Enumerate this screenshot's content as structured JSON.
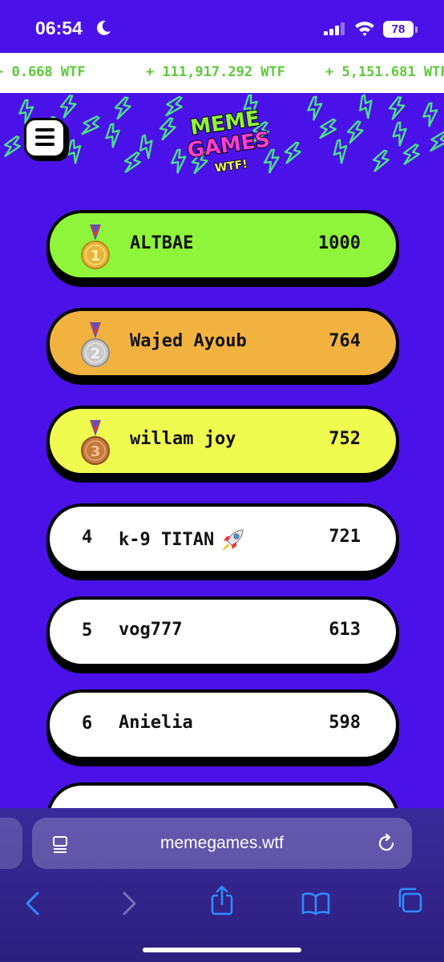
{
  "status_bar": {
    "time": "06:54",
    "battery": "78"
  },
  "ticker": {
    "items": [
      "+ 0.668 WTF",
      "+ 111,917.292 WTF",
      "+ 5,151.681 WTF"
    ]
  },
  "header": {
    "logo_line1": "MEME",
    "logo_line2": "GAMES",
    "logo_line3": "WTF!"
  },
  "leaderboard": {
    "rows": [
      {
        "rank": "1",
        "medal": "gold",
        "name": "ALTBAE",
        "score": "1000",
        "color": "#8ff53a"
      },
      {
        "rank": "2",
        "medal": "silver",
        "name": "Wajed Ayoub",
        "score": "764",
        "color": "#f2b240"
      },
      {
        "rank": "3",
        "medal": "bronze",
        "name": "willam joy",
        "score": "752",
        "color": "#f0fb4f"
      },
      {
        "rank": "4",
        "medal": "",
        "name": "k-9 TITAN",
        "score": "721",
        "color": "#ffffff",
        "icon": "rocket-icon"
      },
      {
        "rank": "5",
        "medal": "",
        "name": "vog777",
        "score": "613",
        "color": "#ffffff"
      },
      {
        "rank": "6",
        "medal": "",
        "name": "Anielia",
        "score": "598",
        "color": "#ffffff"
      }
    ]
  },
  "browser": {
    "url": "memegames.wtf"
  },
  "colors": {
    "background": "#4a12e8",
    "ticker_text": "#5dc93a",
    "bolt": "#4be08a",
    "browser_icon": "#2f8bff"
  }
}
